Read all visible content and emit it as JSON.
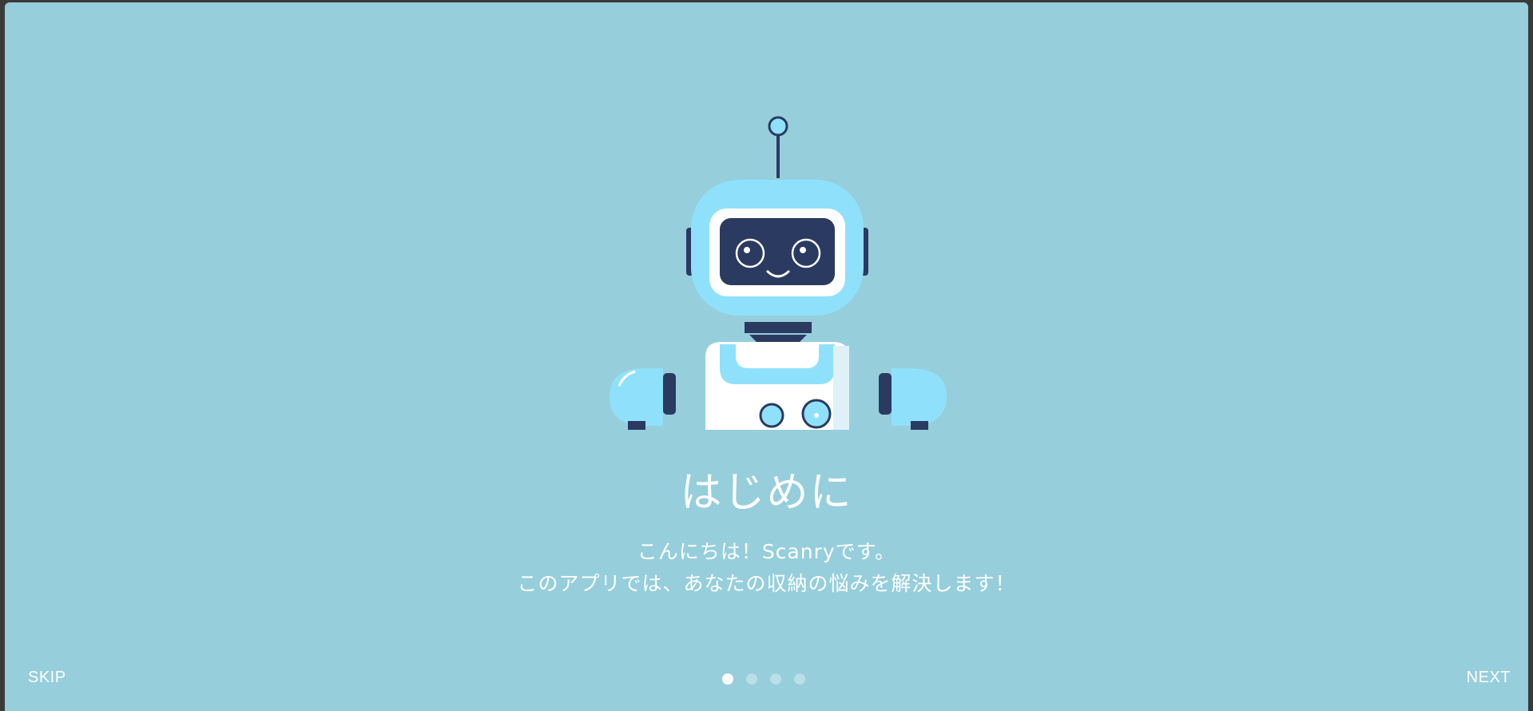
{
  "onboarding": {
    "title": "はじめに",
    "description_line1": "こんにちは！Scanryです。",
    "description_line2": "このアプリでは、あなたの収納の悩みを解決します！",
    "illustration": "robot-illustration"
  },
  "nav": {
    "skip_label": "SKIP",
    "next_label": "NEXT",
    "pages": 4,
    "current_page": 1
  },
  "colors": {
    "background": "#96cedc",
    "text": "#ffffff",
    "robot_light_blue": "#8fe1fb",
    "robot_dark": "#2b3a60"
  }
}
